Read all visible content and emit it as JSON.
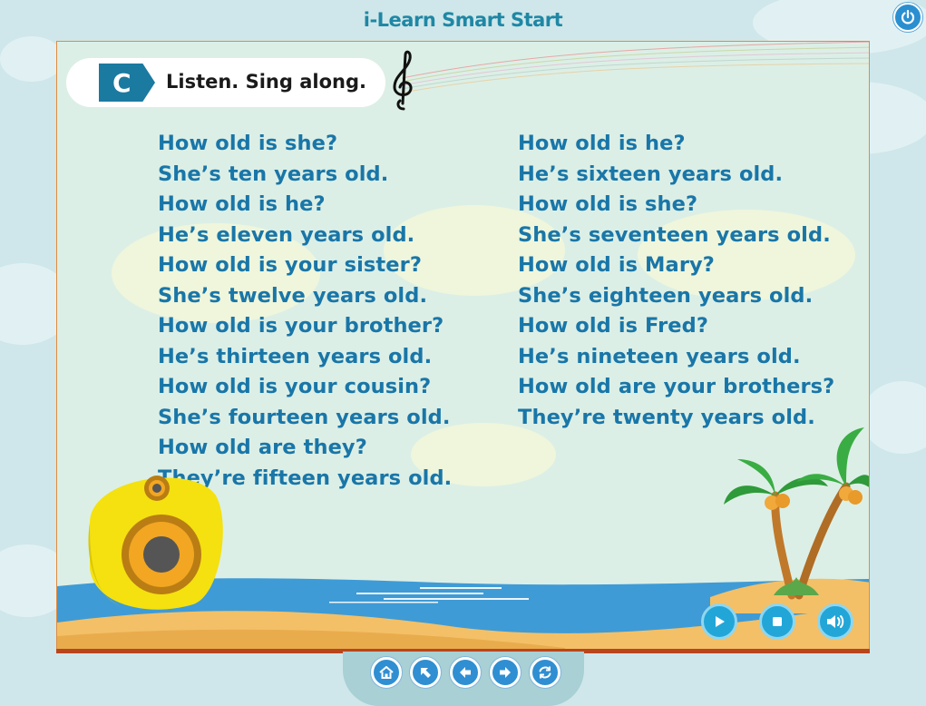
{
  "app": {
    "title": "i-Learn Smart Start"
  },
  "section": {
    "letter": "C",
    "instruction": "Listen. Sing along."
  },
  "lyrics": {
    "left": [
      "How old is she?",
      "She’s ten years old.",
      "How old is he?",
      "He’s eleven years old.",
      "How old is your sister?",
      "She’s twelve years old.",
      "How old is your brother?",
      "He’s thirteen years old.",
      "How old is your cousin?",
      "She’s fourteen years old.",
      "How old are they?",
      "They’re fifteen years old."
    ],
    "right": [
      "How old is he?",
      "He’s sixteen years old.",
      "How old is she?",
      "She’s seventeen years old.",
      "How old is Mary?",
      "She’s eighteen years old.",
      "How old is Fred?",
      "He’s nineteen years old.",
      "How old are your brothers?",
      "They’re twenty years old."
    ]
  },
  "icons": {
    "power": "power-icon",
    "play": "play-icon",
    "stop": "stop-icon",
    "volume": "volume-icon",
    "home": "home-icon",
    "expand": "arrow-up-left-icon",
    "previous": "arrow-left-icon",
    "next": "arrow-right-icon",
    "refresh": "refresh-icon"
  },
  "colors": {
    "title": "#1f87a5",
    "lyrics": "#1976a8",
    "badge": "#1b7aa0",
    "button": "#22a6d8",
    "frame": "#e08b3d"
  }
}
